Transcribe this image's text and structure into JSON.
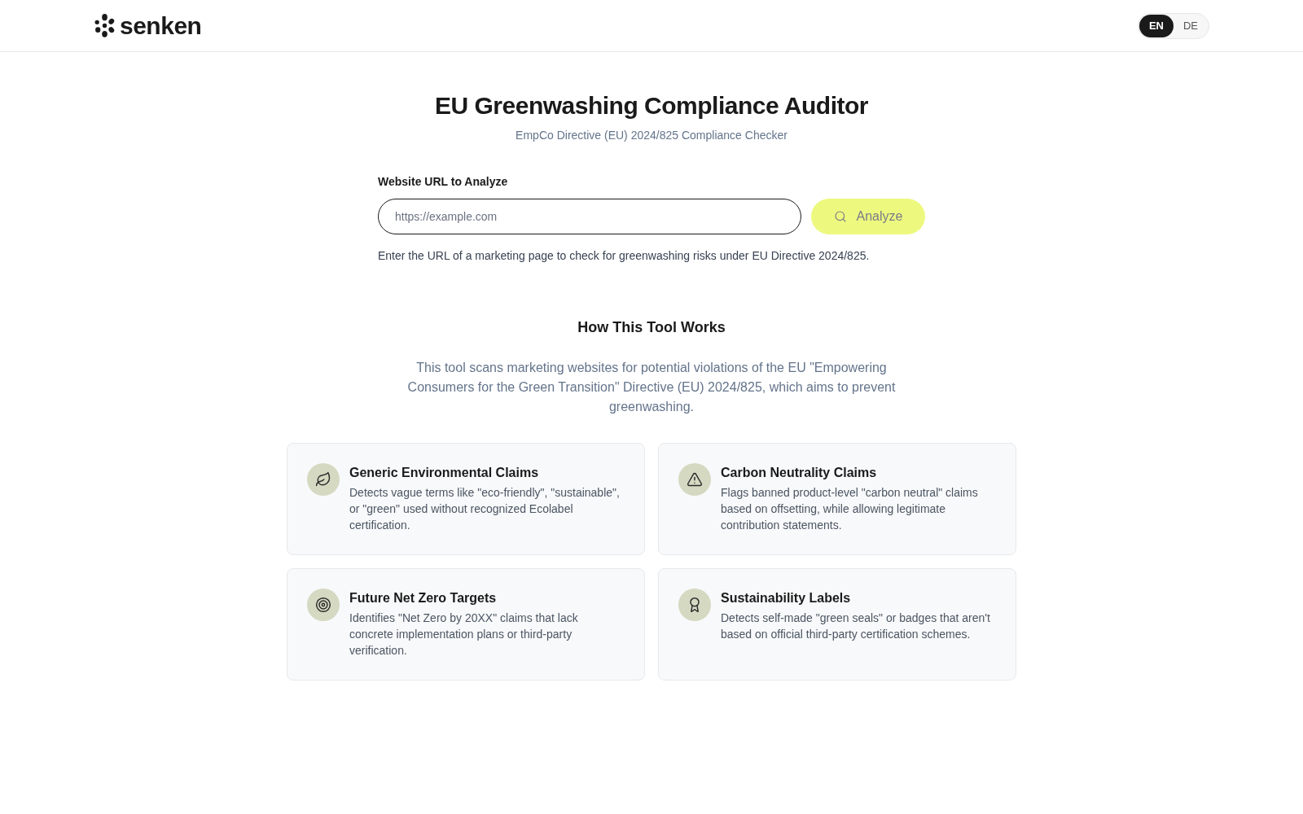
{
  "header": {
    "logo_text": "senken",
    "languages": [
      {
        "label": "EN",
        "selected": true
      },
      {
        "label": "DE",
        "selected": false
      }
    ]
  },
  "hero": {
    "title": "EU Greenwashing Compliance Auditor",
    "subtitle": "EmpCo Directive (EU) 2024/825 Compliance Checker"
  },
  "form": {
    "label": "Website URL to Analyze",
    "url_field": {
      "placeholder": "https://example.com"
    },
    "analyze_button": {
      "label": "Analyze",
      "disabled": true
    },
    "hint": "Enter the URL of a marketing page to check for greenwashing risks under EU Directive 2024/825."
  },
  "how_it_works": {
    "heading": "How This Tool Works",
    "description": "This tool scans marketing websites for potential violations of the EU \"Empowering Consumers for the Green Transition\" Directive (EU) 2024/825, which aims to prevent greenwashing.",
    "features": [
      {
        "kind": "leaf",
        "title": "Generic Environmental Claims",
        "description": "Detects vague terms like \"eco-friendly\", \"sustainable\", or \"green\" used without recognized Ecolabel certification."
      },
      {
        "kind": "warning",
        "title": "Carbon Neutrality Claims",
        "description": "Flags banned product-level \"carbon neutral\" claims based on offsetting, while allowing legitimate contribution statements."
      },
      {
        "kind": "target",
        "title": "Future Net Zero Targets",
        "description": "Identifies \"Net Zero by 20XX\" claims that lack concrete implementation plans or third-party verification."
      },
      {
        "kind": "award",
        "title": "Sustainability Labels",
        "description": "Detects self-made \"green seals\" or badges that aren't based on official third-party certification schemes."
      }
    ]
  }
}
